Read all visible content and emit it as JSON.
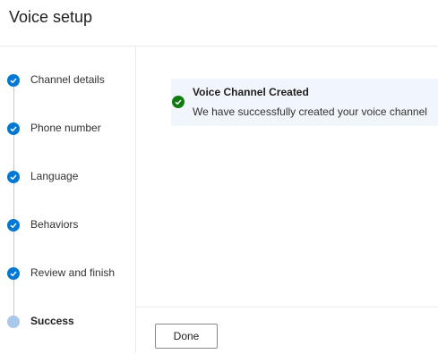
{
  "header": {
    "title": "Voice setup"
  },
  "steps": [
    {
      "label": "Channel details",
      "status": "completed"
    },
    {
      "label": "Phone number",
      "status": "completed"
    },
    {
      "label": "Language",
      "status": "completed"
    },
    {
      "label": "Behaviors",
      "status": "completed"
    },
    {
      "label": "Review and finish",
      "status": "completed"
    },
    {
      "label": "Success",
      "status": "current"
    }
  ],
  "banner": {
    "title": "Voice Channel Created",
    "message": "We have successfully created your voice channel",
    "icon": "check-circle-icon",
    "color": "#107c10"
  },
  "footer": {
    "done_label": "Done"
  },
  "colors": {
    "accent": "#0078d4",
    "success": "#107c10",
    "banner_bg": "#f1f6fc"
  }
}
